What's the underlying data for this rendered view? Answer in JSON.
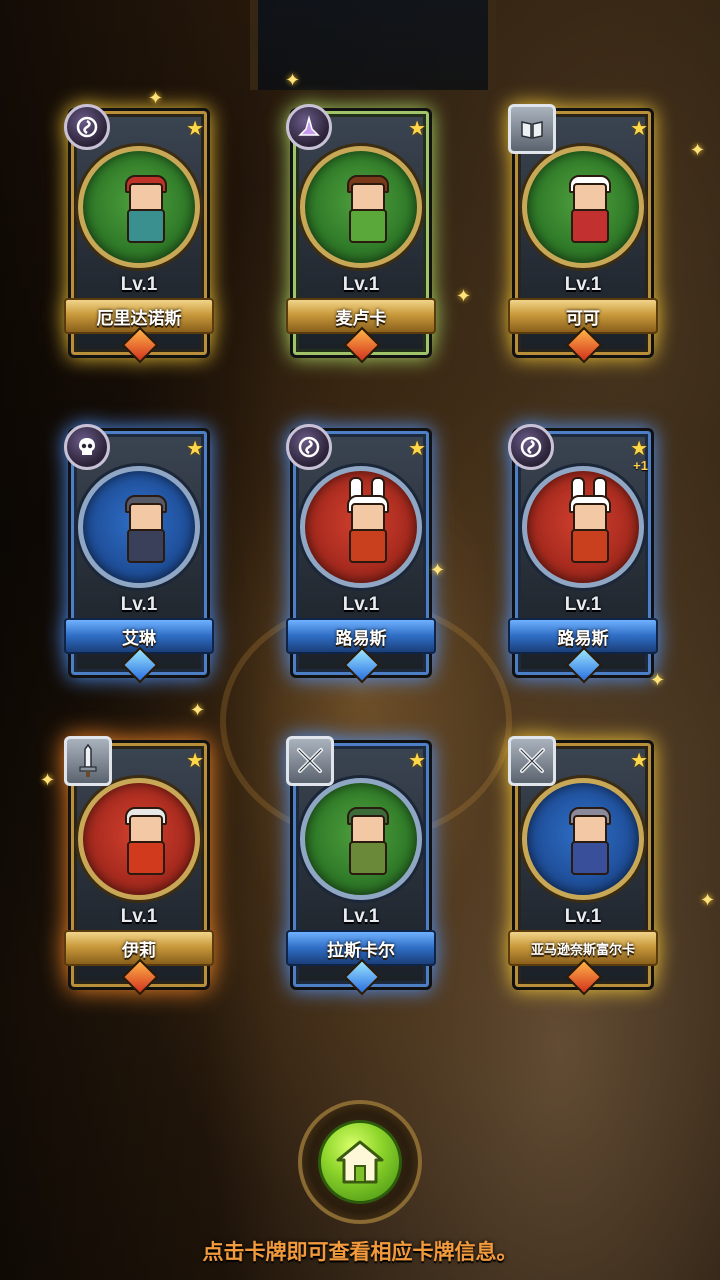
{
  "cards": [
    {
      "name": "厄里达诺斯",
      "level": "Lv.1",
      "frame": "gold",
      "banner": "gold",
      "portrait": "green",
      "class_icon": "magic-orb-icon",
      "stars": "★",
      "plus": "",
      "hair": "#c0332a",
      "outfit": "#3a8f8f"
    },
    {
      "name": "麦卢卡",
      "level": "Lv.1",
      "frame": "green",
      "banner": "gold",
      "portrait": "green",
      "class_icon": "witch-hat-icon",
      "stars": "★",
      "plus": "",
      "hair": "#7a3a1a",
      "outfit": "#5aa83a"
    },
    {
      "name": "可可",
      "level": "Lv.1",
      "frame": "gold",
      "banner": "gold",
      "portrait": "green",
      "class_icon": "book-icon",
      "stars": "★",
      "plus": "",
      "hair": "#ffffff",
      "outfit": "#c23030"
    },
    {
      "name": "艾琳",
      "level": "Lv.1",
      "frame": "blue",
      "banner": "blue",
      "portrait": "blue",
      "class_icon": "skull-icon",
      "stars": "★",
      "plus": "",
      "hair": "#555a66",
      "outfit": "#3a3f5a"
    },
    {
      "name": "路易斯",
      "level": "Lv.1",
      "frame": "blue",
      "banner": "blue",
      "portrait": "red",
      "class_icon": "magic-orb-icon",
      "stars": "★",
      "plus": "",
      "hair": "#ffffff",
      "outfit": "#c8401e"
    },
    {
      "name": "路易斯",
      "level": "Lv.1",
      "frame": "blue",
      "banner": "blue",
      "portrait": "red",
      "class_icon": "magic-orb-icon",
      "stars": "★",
      "plus": "+1",
      "hair": "#ffffff",
      "outfit": "#c8401e"
    },
    {
      "name": "伊莉",
      "level": "Lv.1",
      "frame": "fire",
      "banner": "gold",
      "portrait": "red",
      "class_icon": "sword-icon",
      "stars": "★",
      "plus": "",
      "hair": "#e8e8e8",
      "outfit": "#d23a1e"
    },
    {
      "name": "拉斯卡尔",
      "level": "Lv.1",
      "frame": "blue",
      "banner": "blue",
      "portrait": "green",
      "class_icon": "crossed-swords-icon",
      "stars": "★",
      "plus": "",
      "hair": "#3c6b3a",
      "outfit": "#6a8a3a"
    },
    {
      "name": "亚马逊奈斯富尔卡",
      "level": "Lv.1",
      "frame": "gold",
      "banner": "gold",
      "portrait": "blue",
      "class_icon": "crossed-swords-icon",
      "stars": "★",
      "plus": "",
      "hair": "#8a8a9a",
      "outfit": "#3a4f9a"
    }
  ],
  "home_button": {
    "icon": "home-icon"
  },
  "hint_text": "点击卡牌即可查看相应卡牌信息。"
}
